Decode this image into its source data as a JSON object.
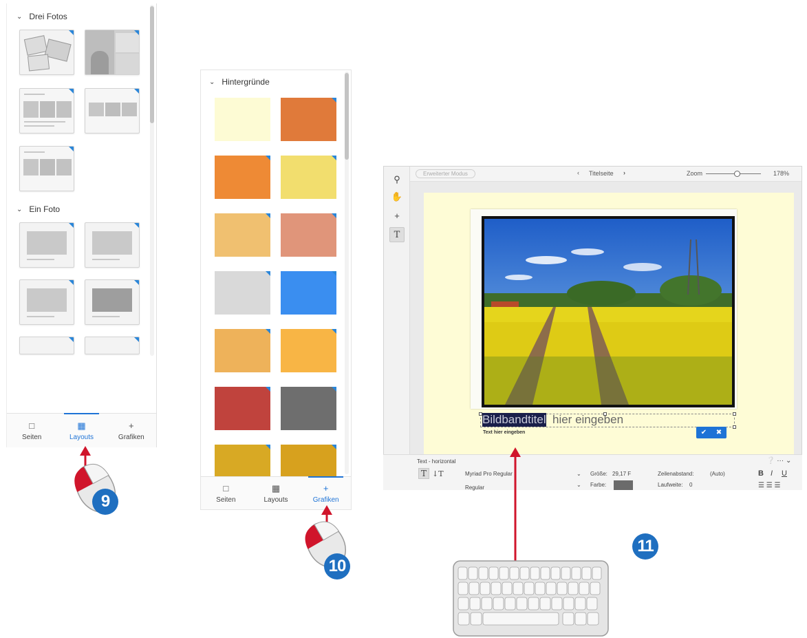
{
  "panel_layouts": {
    "sections": [
      {
        "title": "Drei Fotos"
      },
      {
        "title": "Ein Foto"
      }
    ],
    "tabs": [
      {
        "label": "Seiten",
        "icon": "page-icon"
      },
      {
        "label": "Layouts",
        "icon": "layouts-grid-icon",
        "active": true
      },
      {
        "label": "Grafiken",
        "icon": "plus-icon"
      }
    ]
  },
  "panel_backgrounds": {
    "section_title": "Hintergründe",
    "swatch_colors": [
      "#fdfbd4",
      "#e07a3a",
      "#ee8a35",
      "#f2de6e",
      "#f0c070",
      "#e0957a",
      "#d9d9d9",
      "#3a8ef0",
      "#eeb25a",
      "#f8b545",
      "#c0433d",
      "#6e6e6e",
      "#d8a924",
      "#d7a11e"
    ],
    "tabs": [
      {
        "label": "Seiten",
        "icon": "page-icon"
      },
      {
        "label": "Layouts",
        "icon": "layouts-grid-icon"
      },
      {
        "label": "Grafiken",
        "icon": "plus-icon",
        "active": true
      }
    ]
  },
  "editor": {
    "mode_button": "Erweiterter Modus",
    "page_nav": {
      "prev": "‹",
      "title": "Titelseite",
      "next": "›"
    },
    "zoom": {
      "label": "Zoom",
      "value": "178%"
    },
    "title_text": {
      "selected": "Bildbandtitel",
      "rest": " hier eingeben"
    },
    "subtitle_text": "Text hier eingeben",
    "text_panel": {
      "header": "Text - horizontal",
      "font": "Myriad Pro Regular",
      "style": "Regular",
      "size_label": "Größe:",
      "size_value": "29,17 F",
      "color_label": "Farbe:",
      "leading_label": "Zeilenabstand:",
      "leading_value": "(Auto)",
      "tracking_label": "Laufweite:",
      "tracking_value": "0",
      "bold": "B",
      "italic": "I",
      "underline": "U"
    }
  },
  "step_badges": [
    "9",
    "10",
    "11"
  ],
  "colors": {
    "accent": "#1e73d6",
    "badge": "#1f6fc0",
    "arrow": "#d0152b"
  }
}
